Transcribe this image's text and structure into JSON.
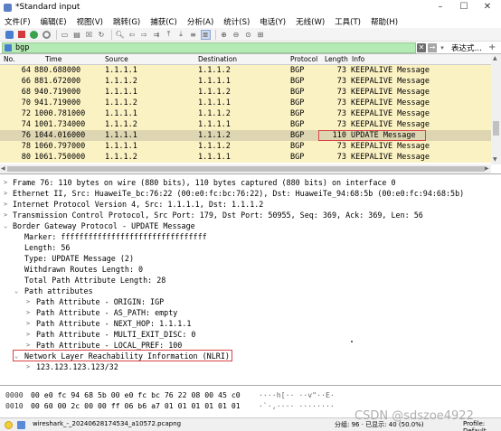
{
  "window": {
    "title": "*Standard input"
  },
  "menu": [
    "文件(F)",
    "编辑(E)",
    "视图(V)",
    "跳转(G)",
    "捕获(C)",
    "分析(A)",
    "统计(S)",
    "电话(Y)",
    "无线(W)",
    "工具(T)",
    "帮助(H)"
  ],
  "toolbar": {
    "icons": [
      "shark-fin-icon",
      "stop-icon",
      "restart-icon",
      "options-gear-icon",
      "open-file-icon",
      "save-file-icon",
      "close-file-icon",
      "reload-icon",
      "find-icon",
      "back-icon",
      "forward-icon",
      "go-to-icon",
      "first-icon",
      "last-icon",
      "autoscroll-icon",
      "colorize-icon",
      "zoom-in-icon",
      "zoom-out-icon",
      "zoom-reset-icon",
      "resize-columns-icon"
    ]
  },
  "filter": {
    "value": "bgp",
    "expression_label": "表达式…",
    "plus_label": "+"
  },
  "packet_list": {
    "columns": [
      "No.",
      "Time",
      "Source",
      "Destination",
      "Protocol",
      "Length",
      "Info"
    ],
    "rows": [
      {
        "no": "64",
        "time": "880.688000",
        "src": "1.1.1.1",
        "dst": "1.1.1.2",
        "proto": "BGP",
        "len": "73",
        "info": "KEEPALIVE Message"
      },
      {
        "no": "66",
        "time": "881.672000",
        "src": "1.1.1.2",
        "dst": "1.1.1.1",
        "proto": "BGP",
        "len": "73",
        "info": "KEEPALIVE Message"
      },
      {
        "no": "68",
        "time": "940.719000",
        "src": "1.1.1.1",
        "dst": "1.1.1.2",
        "proto": "BGP",
        "len": "73",
        "info": "KEEPALIVE Message"
      },
      {
        "no": "70",
        "time": "941.719000",
        "src": "1.1.1.2",
        "dst": "1.1.1.1",
        "proto": "BGP",
        "len": "73",
        "info": "KEEPALIVE Message"
      },
      {
        "no": "72",
        "time": "1000.781000",
        "src": "1.1.1.1",
        "dst": "1.1.1.2",
        "proto": "BGP",
        "len": "73",
        "info": "KEEPALIVE Message"
      },
      {
        "no": "74",
        "time": "1001.734000",
        "src": "1.1.1.2",
        "dst": "1.1.1.1",
        "proto": "BGP",
        "len": "73",
        "info": "KEEPALIVE Message"
      },
      {
        "no": "76",
        "time": "1044.016000",
        "src": "1.1.1.1",
        "dst": "1.1.1.2",
        "proto": "BGP",
        "len": "110",
        "info": "UPDATE Message"
      },
      {
        "no": "78",
        "time": "1060.797000",
        "src": "1.1.1.1",
        "dst": "1.1.1.2",
        "proto": "BGP",
        "len": "73",
        "info": "KEEPALIVE Message"
      },
      {
        "no": "80",
        "time": "1061.750000",
        "src": "1.1.1.2",
        "dst": "1.1.1.1",
        "proto": "BGP",
        "len": "73",
        "info": "KEEPALIVE Message"
      }
    ],
    "selected_row_no": "76"
  },
  "details": {
    "frame": "Frame 76: 110 bytes on wire (880 bits), 110 bytes captured (880 bits) on interface 0",
    "ethernet": "Ethernet II, Src: HuaweiTe_bc:76:22 (00:e0:fc:bc:76:22), Dst: HuaweiTe_94:68:5b (00:e0:fc:94:68:5b)",
    "ip": "Internet Protocol Version 4, Src: 1.1.1.1, Dst: 1.1.1.2",
    "tcp": "Transmission Control Protocol, Src Port: 179, Dst Port: 50955, Seq: 369, Ack: 369, Len: 56",
    "bgp": "Border Gateway Protocol - UPDATE Message",
    "marker": "Marker: ffffffffffffffffffffffffffffffff",
    "length": "Length: 56",
    "type": "Type: UPDATE Message (2)",
    "withdrawn": "Withdrawn Routes Length: 0",
    "total_attr": "Total Path Attribute Length: 28",
    "path_attrs": "Path attributes",
    "attr_origin": "Path Attribute - ORIGIN: IGP",
    "attr_as_path": "Path Attribute - AS_PATH: empty",
    "attr_next_hop": "Path Attribute - NEXT_HOP: 1.1.1.1",
    "attr_med": "Path Attribute - MULTI_EXIT_DISC: 0",
    "attr_local_pref": "Path Attribute - LOCAL_PREF: 100",
    "nlri": "Network Layer Reachability Information (NLRI)",
    "nlri_prefix": "123.123.123.123/32"
  },
  "bytes": [
    {
      "offset": "0000",
      "hex": "00 e0 fc 94 68 5b 00 e0  fc bc 76 22 08 00 45 c0",
      "ascii": "····h[·· ··v\"··E·"
    },
    {
      "offset": "0010",
      "hex": "00 60 00 2c 00 00 ff 06  b6 a7 01 01 01 01 01 01",
      "ascii": "·`·,···· ········"
    }
  ],
  "status": {
    "file": "wireshark_-_20240628174534_a10572.pcapng",
    "stats": "分组: 96 · 已显示: 40 (50.0%)",
    "profile": "Profile: Default"
  },
  "watermark": "CSDN @sdszoe4922",
  "colors": {
    "row_bgp": "#fbf2c4",
    "row_selected": "#ded6b2",
    "filter_ok": "#b4ebb4",
    "highlight_box": "#d94444"
  }
}
